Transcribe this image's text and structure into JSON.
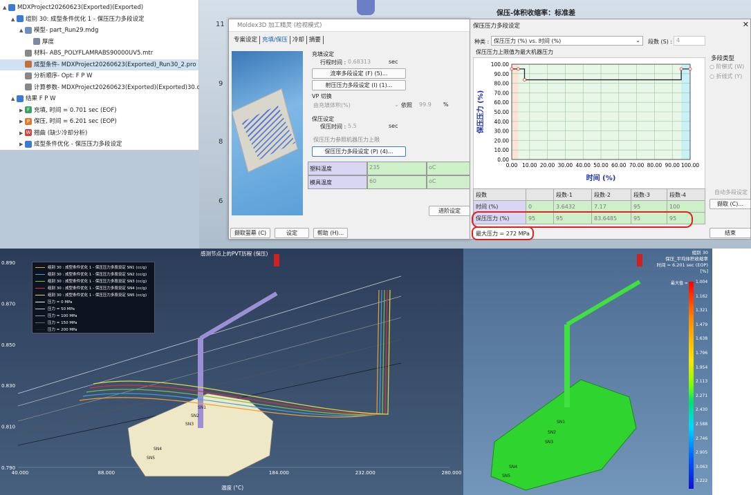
{
  "tree": {
    "items": [
      {
        "label": "MDXProject20260623(Exported)(Exported)",
        "indent": 0,
        "twisty": "▲",
        "icon_color": "#3b7bd3"
      },
      {
        "label": "组别 30: 成型条件优化 1 - 保压压力多段设定",
        "indent": 1,
        "twisty": "▲",
        "icon_color": "#3b7bd3"
      },
      {
        "label": "模型- part_Run29.mdg",
        "indent": 2,
        "twisty": "▲",
        "icon_color": "#6f8fbf"
      },
      {
        "label": "厚度",
        "indent": 3,
        "twisty": "",
        "icon_color": "#7a8aa0"
      },
      {
        "label": "材料- ABS_POLYFLAMRABS90000UV5.mtr",
        "indent": 2,
        "twisty": "",
        "icon_color": "#888"
      },
      {
        "label": "成型条件- MDXProject20260623(Exported)_Run30_2.pro",
        "indent": 2,
        "twisty": "",
        "icon_color": "#c0703a",
        "selected": true
      },
      {
        "label": "分析顺序- Opt: F P W",
        "indent": 2,
        "twisty": "",
        "icon_color": "#888"
      },
      {
        "label": "计算参数- MDXProject20260623(Exported)(Exported)30.cmx",
        "indent": 2,
        "twisty": "",
        "icon_color": "#888"
      },
      {
        "label": "结果  F P W",
        "indent": 1,
        "twisty": "▲",
        "icon_color": "#3b7bd3"
      },
      {
        "label": "充填, 时间 = 0.701 sec (EOF)",
        "indent": 2,
        "twisty": "▶",
        "icon_color": "#3aa060",
        "letter": "F"
      },
      {
        "label": "保压, 时间 = 6.201 sec (EOP)",
        "indent": 2,
        "twisty": "▶",
        "icon_color": "#e07a2a",
        "letter": "P"
      },
      {
        "label": "翘曲 (缺少冷却分析)",
        "indent": 2,
        "twisty": "▶",
        "icon_color": "#d04040",
        "letter": "W"
      },
      {
        "label": "成型条件优化 - 保压压力多段设定",
        "indent": 2,
        "twisty": "▶",
        "icon_color": "#3b7bd3"
      }
    ]
  },
  "top_title": "保压-体积收缩率：标准差",
  "side_labels": [
    "11",
    "9",
    "8",
    "6"
  ],
  "dialog1": {
    "title": "Moldex3D 加工精灵 (检视模式)",
    "tabs": [
      "专案设定",
      "充填/保压",
      "冷却",
      "摘要"
    ],
    "fill_section": "充填设定",
    "fill_time_label": "行程时间 :",
    "fill_time_value": "0.68313",
    "fill_time_unit": "sec",
    "flow_rate_button": "流率多段设定 (F) (5)...",
    "inj_pressure_button": "射压压力多段设定 (I) (1)...",
    "vp_section": "VP 切换",
    "vp_mode": "由充填体积(%)",
    "vp_basis_label": "依照",
    "vp_basis_value": "99.9",
    "vp_basis_unit": "%",
    "pack_section": "保压设定",
    "pack_time_label": "保压时间 :",
    "pack_time_value": "5.5",
    "pack_time_unit": "sec",
    "pack_ref_label": "保压压力参照机器压力上限",
    "pack_multi_button": "保压压力多段设定 (P) (4)...",
    "temps": [
      {
        "label": "塑料温度",
        "value": "235",
        "unit": "oC"
      },
      {
        "label": "模具温度",
        "value": "60",
        "unit": "oC"
      }
    ],
    "advanced_button": "进阶设定",
    "buttons": {
      "read_filter": "撷取萤幕 (C)",
      "settings": "设定",
      "help": "帮助 (H)..."
    }
  },
  "dialog2": {
    "title": "保压压力多段设定",
    "type_label": "种类 :",
    "type_value": "保压压力 (%) vs. 时间 (%)",
    "segments_label": "段数 (S) :",
    "segments_value": "4",
    "chart_caption": "保压压力上限值为最大机器压力",
    "multi_type_title": "多段类型",
    "radio_step": "阶梯式 (W)",
    "radio_line": "折线式 (Y)",
    "auto_button": "自动多段设定",
    "fetch_button": "撷取 (C)...",
    "ok_button": "结束",
    "table_headers": [
      "段数",
      "",
      "段数-1",
      "段数-2",
      "段数-3",
      "段数-4"
    ],
    "row_time": {
      "label": "时间 (%)",
      "values": [
        "0",
        "3.6432",
        "7.17",
        "95",
        "100"
      ]
    },
    "row_pressure": {
      "label": "保压压力 (%)",
      "values": [
        "95",
        "95",
        "83.6485",
        "95",
        "95"
      ]
    },
    "max_pressure": "最大压力 = 272 MPa",
    "chart_data": {
      "type": "line",
      "xlabel": "时间 (%)",
      "ylabel": "保压压力 (%)",
      "xlim": [
        0,
        100
      ],
      "ylim": [
        0,
        100
      ],
      "x": [
        0,
        3.6432,
        7.17,
        95,
        100
      ],
      "y": [
        95,
        95,
        83.6485,
        95,
        95
      ],
      "xticks": [
        "0.00",
        "10.00",
        "20.00",
        "30.00",
        "40.00",
        "50.00",
        "60.00",
        "70.00",
        "80.00",
        "90.00",
        "100.00"
      ],
      "yticks": [
        "0.00",
        "10.00",
        "20.00",
        "30.00",
        "40.00",
        "50.00",
        "60.00",
        "70.00",
        "80.00",
        "90.00",
        "100.00"
      ],
      "grid": true
    }
  },
  "pvt": {
    "title": "感测节点上的PVT历程 (保压)",
    "xlabel": "温度 (°C)",
    "xticks": [
      "40.000",
      "88.000",
      "136.000",
      "184.000",
      "232.000",
      "280.000"
    ],
    "yticks": [
      "0.890",
      "0.870",
      "0.850",
      "0.830",
      "0.810",
      "0.790"
    ],
    "legend": [
      {
        "label": "组别 30 : 成型条件优化 1 - 保压压力多段设定 SN1 (cc/g)",
        "color": "#f0a030"
      },
      {
        "label": "组别 30 : 成型条件优化 1 - 保压压力多段设定 SN2 (cc/g)",
        "color": "#40a0e0"
      },
      {
        "label": "组别 30 : 成型条件优化 1 - 保压压力多段设定 SN3 (cc/g)",
        "color": "#80c040"
      },
      {
        "label": "组别 30 : 成型条件优化 1 - 保压压力多段设定 SN4 (cc/g)",
        "color": "#e03030"
      },
      {
        "label": "组别 30 : 成型条件优化 1 - 保压压力多段设定 SN5 (cc/g)",
        "color": "#e0e040"
      },
      {
        "label": "压力 = 0 MPa",
        "color": "#ffffff"
      },
      {
        "label": "压力 = 50 MPa",
        "color": "#cccccc"
      },
      {
        "label": "压力 = 100 MPa",
        "color": "#999999"
      },
      {
        "label": "压力 = 150 MPa",
        "color": "#666666"
      },
      {
        "label": "压力 = 200 MPa",
        "color": "#222222"
      }
    ],
    "sensors": [
      "SN1",
      "SN2",
      "SN3",
      "SN4",
      "SN5"
    ]
  },
  "result": {
    "header1": "组别 30",
    "header2": "保压_平均体积收缩率",
    "header3": "时间 = 6.201 sec (EOP)",
    "unit": "[%]",
    "max_label": "最大值 =",
    "scale": [
      "1.004",
      "1.162",
      "1.321",
      "1.479",
      "1.638",
      "1.796",
      "1.954",
      "2.113",
      "2.271",
      "2.430",
      "2.588",
      "2.746",
      "2.905",
      "3.063",
      "3.222"
    ],
    "sensors": [
      "SN1",
      "SN2",
      "SN3",
      "SN4",
      "SN5"
    ]
  }
}
